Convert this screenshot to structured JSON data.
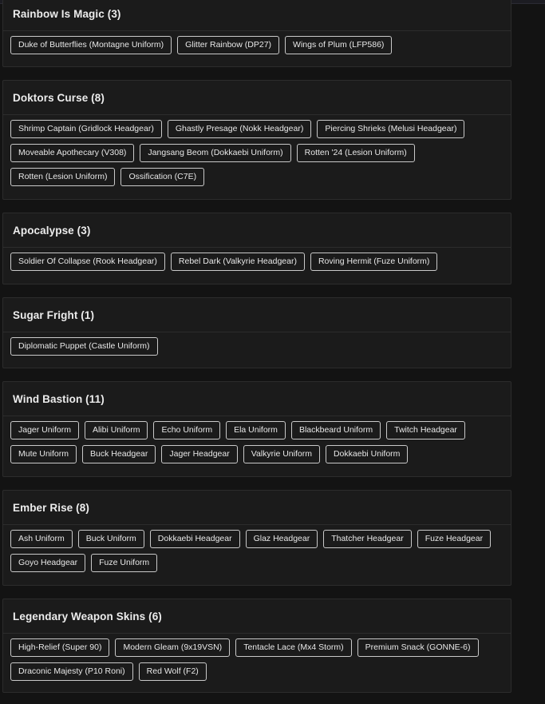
{
  "sections": [
    {
      "title": "Rainbow Is Magic (3)",
      "items": [
        "Duke of Butterflies (Montagne Uniform)",
        "Glitter Rainbow (DP27)",
        "Wings of Plum (LFP586)"
      ]
    },
    {
      "title": "Doktors Curse (8)",
      "items": [
        "Shrimp Captain (Gridlock Headgear)",
        "Ghastly Presage (Nokk Headgear)",
        "Piercing Shrieks (Melusi Headgear)",
        "Moveable Apothecary (V308)",
        "Jangsang Beom (Dokkaebi Uniform)",
        "Rotten '24 (Lesion Uniform)",
        "Rotten (Lesion Uniform)",
        "Ossification (C7E)"
      ]
    },
    {
      "title": "Apocalypse (3)",
      "items": [
        "Soldier Of Collapse (Rook Headgear)",
        "Rebel Dark (Valkyrie Headgear)",
        "Roving Hermit (Fuze Uniform)"
      ]
    },
    {
      "title": "Sugar Fright (1)",
      "items": [
        "Diplomatic Puppet (Castle Uniform)"
      ]
    },
    {
      "title": "Wind Bastion (11)",
      "items": [
        "Jager Uniform",
        "Alibi Uniform",
        "Echo Uniform",
        "Ela Uniform",
        "Blackbeard Uniform",
        "Twitch Headgear",
        "Mute Uniform",
        "Buck Headgear",
        "Jager Headgear",
        "Valkyrie Uniform",
        "Dokkaebi Uniform"
      ]
    },
    {
      "title": "Ember Rise (8)",
      "items": [
        "Ash Uniform",
        "Buck Uniform",
        "Dokkaebi Headgear",
        "Glaz Headgear",
        "Thatcher Headgear",
        "Fuze Headgear",
        "Goyo Headgear",
        "Fuze Uniform"
      ]
    },
    {
      "title": "Legendary Weapon Skins (6)",
      "items": [
        "High-Relief (Super 90)",
        "Modern Gleam (9x19VSN)",
        "Tentacle Lace (Mx4 Storm)",
        "Premium Snack (GONNE-6)",
        "Draconic Majesty (P10 Roni)",
        "Red Wolf (F2)"
      ]
    }
  ]
}
